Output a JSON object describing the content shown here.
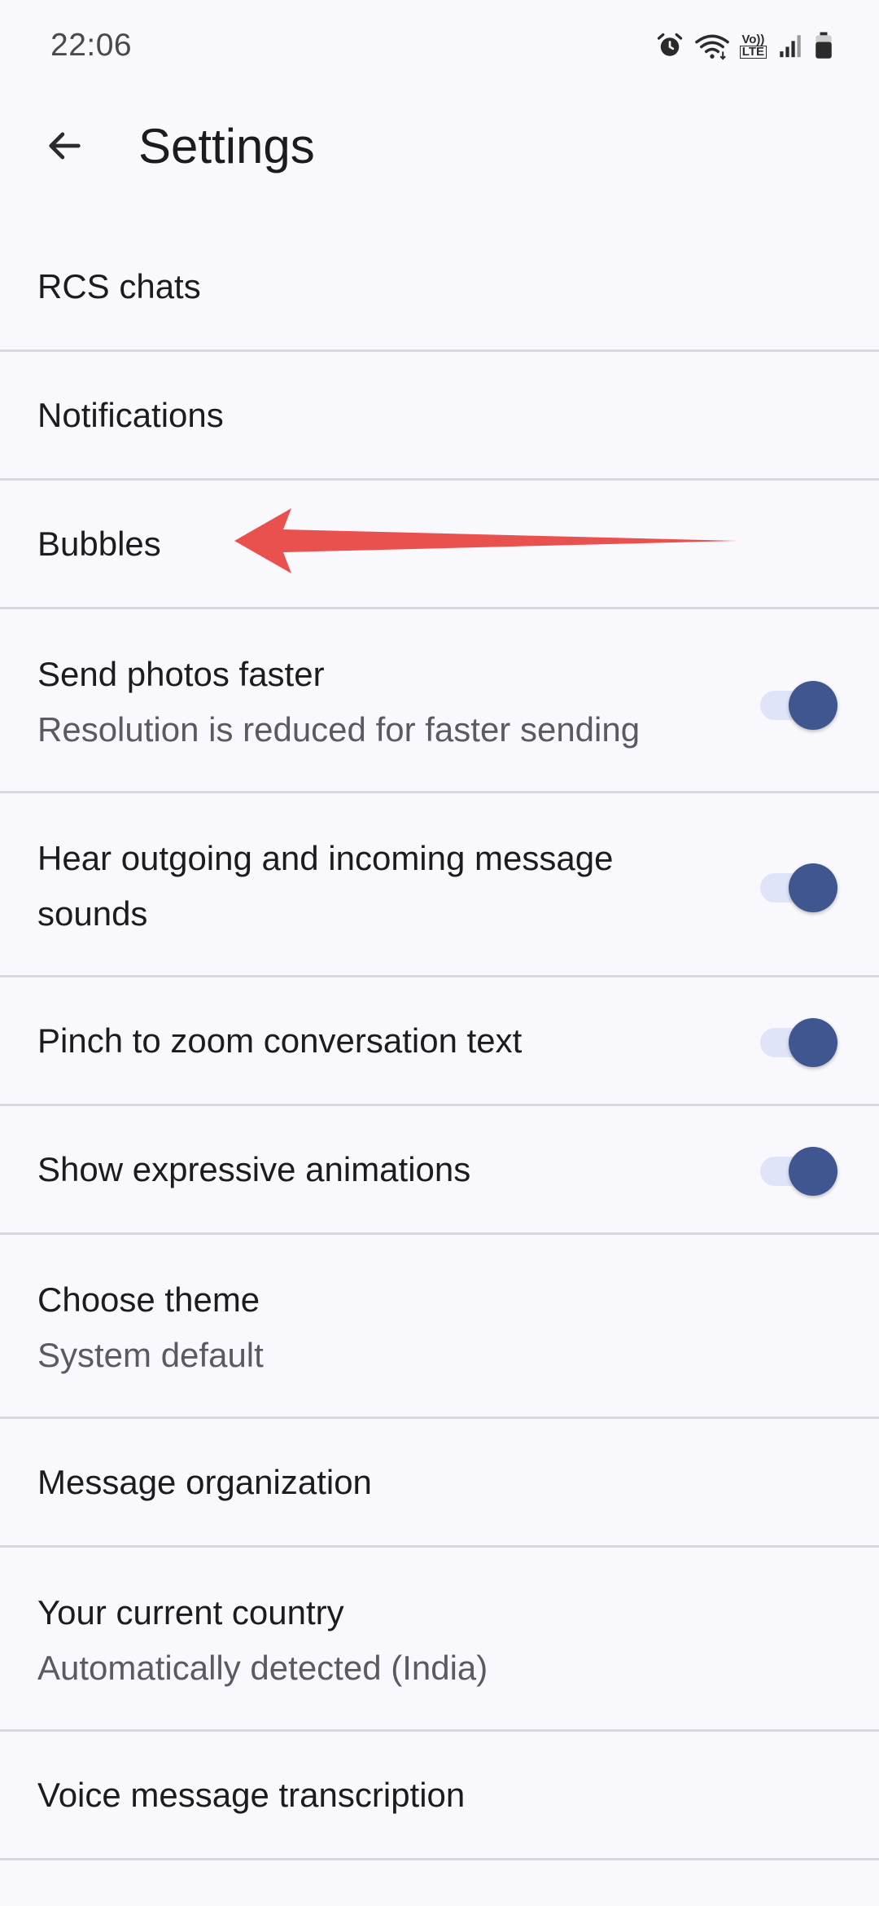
{
  "status_bar": {
    "time": "22:06",
    "icons": [
      "alarm-icon",
      "wifi-icon",
      "volte-icon",
      "cell-signal-icon",
      "battery-icon"
    ],
    "volte_label_top": "Vo))",
    "volte_label_bottom": "LTE"
  },
  "header": {
    "back_icon": "arrow-left-icon",
    "title": "Settings"
  },
  "settings": {
    "rcs_chats": {
      "title": "RCS chats"
    },
    "notifications": {
      "title": "Notifications"
    },
    "bubbles": {
      "title": "Bubbles"
    },
    "send_photos_faster": {
      "title": "Send photos faster",
      "subtitle": "Resolution is reduced for faster sending",
      "enabled": true
    },
    "message_sounds": {
      "title_line1": "Hear outgoing and incoming message",
      "title_line2": "sounds",
      "enabled": true
    },
    "pinch_to_zoom": {
      "title": "Pinch to zoom conversation text",
      "enabled": true
    },
    "expressive_animations": {
      "title": "Show expressive animations",
      "enabled": true
    },
    "choose_theme": {
      "title": "Choose theme",
      "subtitle": "System default"
    },
    "message_organization": {
      "title": "Message organization"
    },
    "current_country": {
      "title": "Your current country",
      "subtitle": "Automatically detected (India)"
    },
    "voice_transcription": {
      "title": "Voice message transcription"
    }
  },
  "colors": {
    "background": "#f8f8fd",
    "divider": "#d8d8de",
    "toggle_thumb": "#3f5691",
    "toggle_track": "#dfe4f8",
    "annotation_arrow": "#e8514d"
  }
}
